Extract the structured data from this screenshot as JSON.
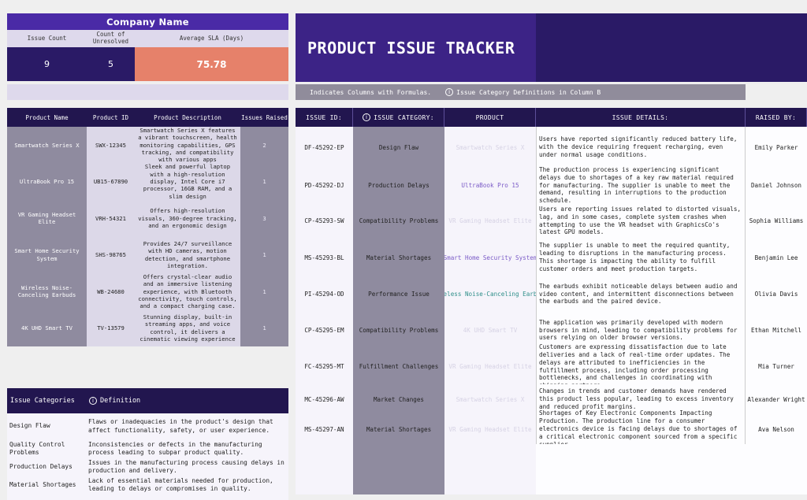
{
  "summary": {
    "company": "Company Name",
    "headers": [
      "Issue Count",
      "Count of Unresolved",
      "Average SLA (Days)"
    ],
    "issue_count": "9",
    "unresolved": "5",
    "avg_sla": "75.78"
  },
  "banner": {
    "title": "PRODUCT ISSUE TRACKER",
    "formula_note": "Indicates Columns with Formulas.",
    "definitions_note": "Issue Category Definitions in Column B"
  },
  "products": {
    "headers": [
      "Product Name",
      "Product ID",
      "Product Description",
      "Issues Raised"
    ],
    "rows": [
      {
        "name": "Smartwatch Series X",
        "id": "SWX-12345",
        "desc": "Smartwatch Series X features a vibrant touchscreen, health monitoring capabilities, GPS tracking, and compatibility with various apps",
        "issues": "2"
      },
      {
        "name": "UltraBook Pro 15",
        "id": "UB15-67890",
        "desc": "Sleek and powerful laptop with a high-resolution display, Intel Core i7 processor, 16GB RAM, and a slim design",
        "issues": "1"
      },
      {
        "name": "VR Gaming Headset Elite",
        "id": "VRH-54321",
        "desc": "Offers high-resolution visuals, 360-degree tracking, and an ergonomic design",
        "issues": "3"
      },
      {
        "name": "Smart Home Security System",
        "id": "SHS-98765",
        "desc": "Provides 24/7 surveillance with HD cameras, motion detection, and smartphone integration.",
        "issues": "1"
      },
      {
        "name": "Wireless Noise-Canceling Earbuds",
        "id": "WB-24680",
        "desc": "Offers crystal-clear audio and an immersive listening experience, with Bluetooth connectivity, touch controls, and a compact charging case.",
        "issues": "1"
      },
      {
        "name": "4K UHD Smart TV",
        "id": "TV-13579",
        "desc": "Stunning display, built-in streaming apps, and voice control, it delivers a cinematic viewing experience",
        "issues": "1"
      }
    ]
  },
  "categories": {
    "headers": [
      "Issue Categories",
      "Definition"
    ],
    "rows": [
      {
        "name": "Design Flaw",
        "def": "Flaws or inadequacies in the product's design that affect functionality, safety, or user experience."
      },
      {
        "name": "Quality Control Problems",
        "def": "Inconsistencies or defects in the manufacturing process leading to subpar product quality."
      },
      {
        "name": "Production Delays",
        "def": "Issues in the manufacturing process causing delays in production and delivery."
      },
      {
        "name": "Material Shortages",
        "def": "Lack of essential materials needed for production, leading to delays or compromises in quality."
      }
    ]
  },
  "issues": {
    "headers": [
      "ISSUE ID:",
      "ISSUE CATEGORY:",
      "PRODUCT",
      "ISSUE DETAILS:",
      "RAISED BY:"
    ],
    "rows": [
      {
        "id": "DF-45292-EP",
        "category": "Design Flaw",
        "product": "Smartwatch Series X",
        "details": "Users have reported significantly reduced battery life, with the device requiring frequent recharging, even under normal usage conditions.",
        "raised_by": "Emily Parker"
      },
      {
        "id": "PD-45292-DJ",
        "category": "Production Delays",
        "product": "UltraBook Pro 15",
        "details": "The production process is experiencing significant delays due to shortages of a key raw material required for manufacturing. The supplier is unable to meet the demand, resulting in interruptions to the production schedule.",
        "raised_by": "Daniel Johnson"
      },
      {
        "id": "CP-45293-SW",
        "category": "Compatibility Problems",
        "product": "VR Gaming Headset Elite",
        "details": "Users are reporting issues related to distorted visuals, lag, and in some cases, complete system crashes when attempting to use the VR headset with GraphicsCo's latest GPU models.",
        "raised_by": "Sophia Williams"
      },
      {
        "id": "MS-45293-BL",
        "category": "Material Shortages",
        "product": "Smart Home Security System",
        "details": "The supplier is unable to meet the required quantity, leading to disruptions in the manufacturing process. This shortage is impacting the ability to fulfill customer orders and meet production targets.",
        "raised_by": "Benjamin Lee"
      },
      {
        "id": "PI-45294-OD",
        "category": "Performance Issue",
        "product": "Wireless Noise-Canceling Earbuds",
        "details": "The earbuds exhibit noticeable delays between audio and video content, and intermittent disconnections between the earbuds and the paired device.",
        "raised_by": "Olivia Davis"
      },
      {
        "id": "CP-45295-EM",
        "category": "Compatibility Problems",
        "product": "4K UHD Smart TV",
        "details": "The application was primarily developed with modern browsers in mind, leading to compatibility problems for users relying on older browser versions.",
        "raised_by": "Ethan Mitchell"
      },
      {
        "id": "FC-45295-MT",
        "category": "Fulfillment Challenges",
        "product": "VR Gaming Headset Elite",
        "details": "Customers are expressing dissatisfaction due to late deliveries and a lack of real-time order updates. The delays are attributed to inefficiencies in the fulfillment process, including order processing bottlenecks, and challenges in coordinating with shipping partners.",
        "raised_by": "Mia Turner"
      },
      {
        "id": "MC-45296-AW",
        "category": "Market Changes",
        "product": "Smartwatch Series X",
        "details": "Changes in trends and customer demands have rendered this product less popular, leading to excess inventory and reduced profit margins.",
        "raised_by": "Alexander Wright"
      },
      {
        "id": "MS-45297-AN",
        "category": "Material Shortages",
        "product": "VR Gaming Headset Elite",
        "details": "Shortages of Key Electronic Components Impacting Production. The production line for a consumer electronics device is facing delays due to shortages of a critical electronic component sourced from a specific supplier.",
        "raised_by": "Ava Nelson"
      }
    ]
  },
  "colors": {
    "product_purple": "#7b5bc7",
    "product_teal": "#2f8f8a",
    "product_faint": "#d6d2e4"
  }
}
